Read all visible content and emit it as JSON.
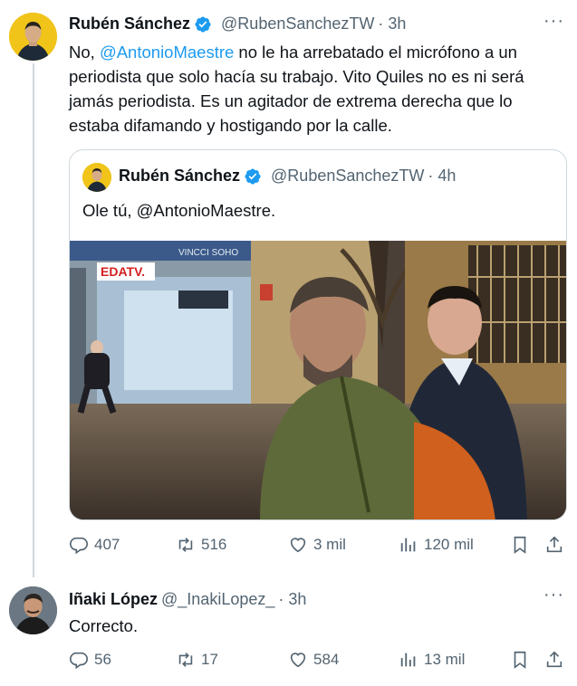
{
  "tweet1": {
    "name": "Rubén Sánchez",
    "handle": "@RubenSanchezTW",
    "time": "· 3h",
    "more": "···",
    "text_before": "No, ",
    "mention": "@AntonioMaestre",
    "text_after": " no le ha arrebatado el micrófono a un periodista que solo hacía su trabajo. Vito Quiles no es ni será jamás periodista. Es un agitador de extrema derecha que lo estaba difamando y hostigando por la calle.",
    "stats": {
      "replies": "407",
      "retweets": "516",
      "likes": "3 mil",
      "views": "120 mil"
    }
  },
  "quote": {
    "name": "Rubén Sánchez",
    "handle": "@RubenSanchezTW",
    "time": "· 4h",
    "text": "Ole tú, @AntonioMaestre.",
    "video_logo": "EDATV.",
    "video_sign": "VINCCI SOHO"
  },
  "tweet2": {
    "name": "Iñaki López",
    "handle": "@_InakiLopez_",
    "time": "· 3h",
    "more": "···",
    "text": "Correcto.",
    "stats": {
      "replies": "56",
      "retweets": "17",
      "likes": "584",
      "views": "13 mil"
    }
  },
  "colors": {
    "accent": "#1d9bf0",
    "muted": "#536471",
    "border": "#cfd9de",
    "verified": "#1d9bf0"
  }
}
